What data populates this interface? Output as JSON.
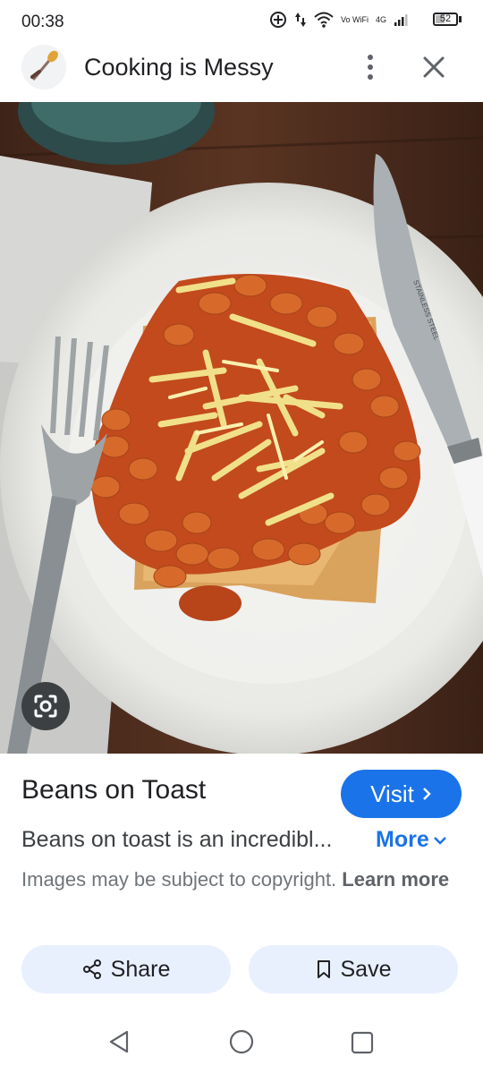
{
  "status_bar": {
    "time": "00:38",
    "network_label": "Vo WiFi",
    "signal_label": "4G",
    "battery_level": "52"
  },
  "header": {
    "site_title": "Cooking is Messy",
    "logo_icon": "whisk-spoon-logo",
    "menu_icon": "more-vert-icon",
    "close_icon": "close-icon"
  },
  "image": {
    "subject": "beans-on-toast-photo",
    "lens_icon": "google-lens-icon"
  },
  "result": {
    "title": "Beans on Toast",
    "visit_label": "Visit",
    "description": "Beans on toast is an incredibl...",
    "more_label": "More",
    "copyright_text": "Images may be subject to copyright.",
    "learn_more_label": "Learn more",
    "share_label": "Share",
    "save_label": "Save"
  },
  "colors": {
    "accent": "#1a73e8",
    "pill_background": "#e8f0fe",
    "text_primary": "#202124",
    "text_secondary": "#70757a"
  }
}
